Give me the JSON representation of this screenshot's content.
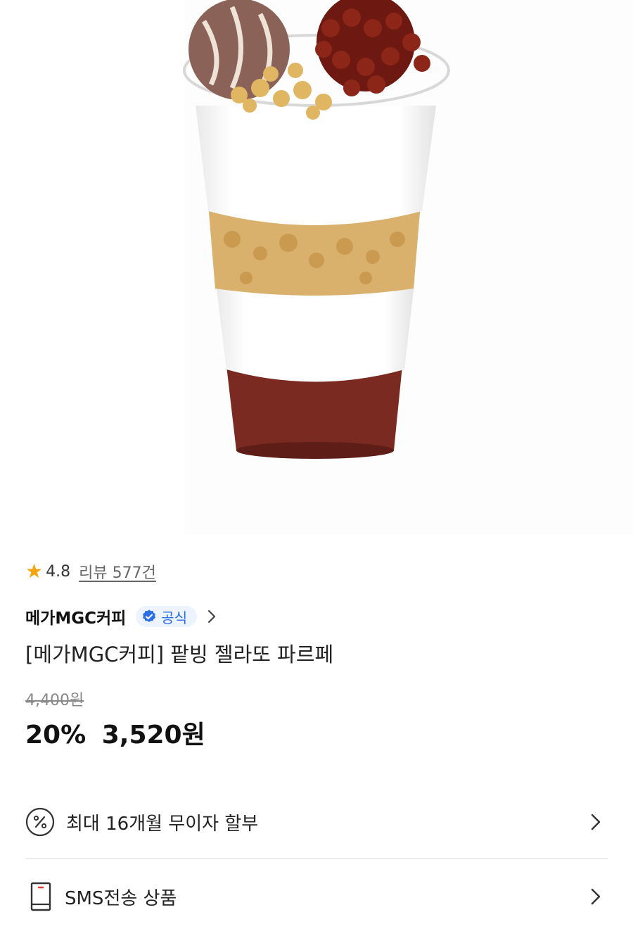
{
  "rating": {
    "value": "4.8",
    "review_link": "리뷰 577건"
  },
  "brand": {
    "name": "메가MGC커피",
    "badge": "공식"
  },
  "product": {
    "title": "[메가MGC커피] 팥빙 젤라또 파르페"
  },
  "price": {
    "original": "4,400원",
    "discount": "20%",
    "final": "3,520원"
  },
  "options": [
    {
      "label": "최대 16개월 무이자 할부",
      "icon": "percent-circle-icon"
    },
    {
      "label": "SMS전송 상품",
      "icon": "phone-icon"
    }
  ],
  "colors": {
    "star": "#f5a50b",
    "badge_text": "#2b6ee6",
    "badge_bg": "#eef4ff"
  }
}
